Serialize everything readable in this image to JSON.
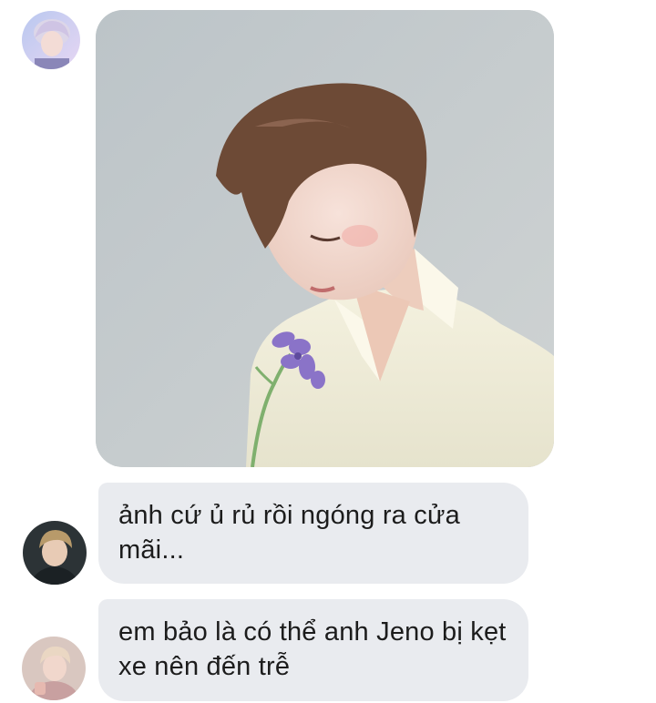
{
  "conversation": {
    "messages": [
      {
        "sender_avatar": "avatar-pastel-blonde-icon",
        "type": "image",
        "image_desc_icon": "photo-man-white-shirt-purple-flower-icon"
      },
      {
        "sender_avatar": "avatar-dark-jacket-icon",
        "type": "text",
        "text": "ảnh cứ ủ rủ rồi ngóng ra cửa mãi..."
      },
      {
        "sender_avatar": "avatar-pink-blonde-icon",
        "type": "text",
        "text": "em bảo là có thể anh Jeno bị kẹt xe nên đến trễ"
      }
    ]
  },
  "colors": {
    "bubble_bg": "#e9ebef",
    "text": "#1c1c1c",
    "photo_bg": "#c7ccce"
  }
}
